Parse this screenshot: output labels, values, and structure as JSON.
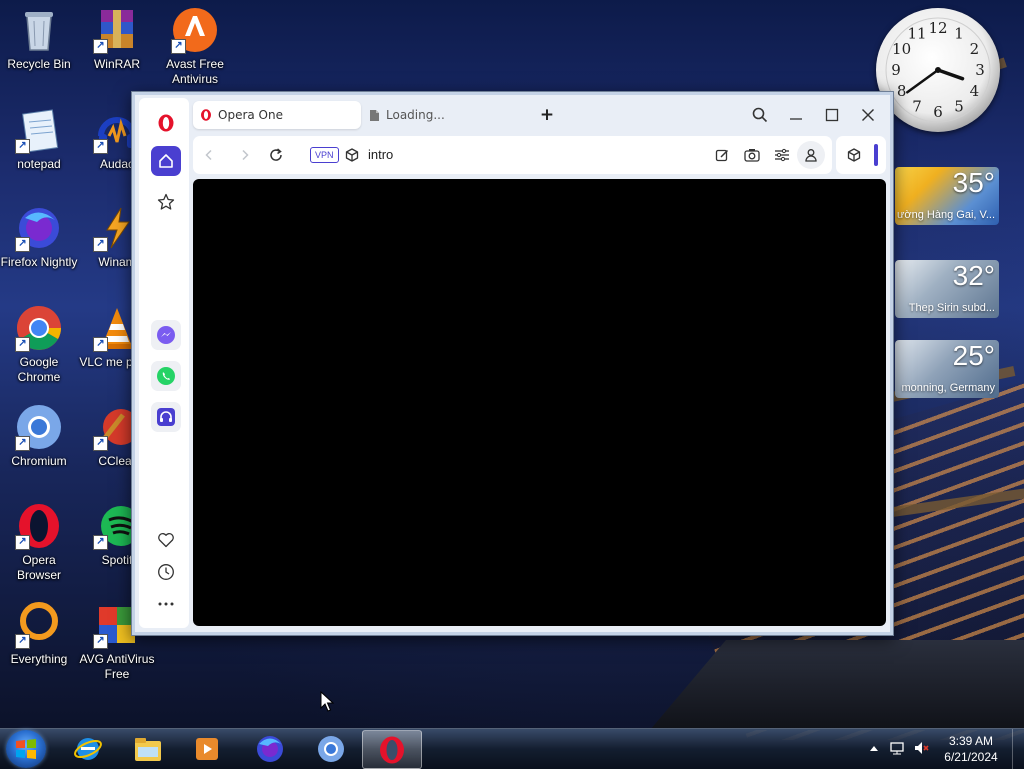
{
  "desktop": {
    "icons": [
      {
        "label": "Recycle Bin",
        "icon": "recycle-bin-icon"
      },
      {
        "label": "WinRAR",
        "icon": "winrar-icon"
      },
      {
        "label": "Avast Free Antivirus",
        "icon": "avast-icon"
      },
      {
        "label": "notepad",
        "icon": "notepad-icon"
      },
      {
        "label": "Audac",
        "icon": "audacity-icon"
      },
      {
        "label": "Firefox Nightly",
        "icon": "firefox-nightly-icon"
      },
      {
        "label": "Winam",
        "icon": "winamp-icon"
      },
      {
        "label": "Google Chrome",
        "icon": "chrome-icon"
      },
      {
        "label": "VLC me playe",
        "icon": "vlc-icon"
      },
      {
        "label": "Chromium",
        "icon": "chromium-icon"
      },
      {
        "label": "CClear",
        "icon": "ccleaner-icon"
      },
      {
        "label": "Opera Browser",
        "icon": "opera-icon"
      },
      {
        "label": "Spotif",
        "icon": "spotify-icon"
      },
      {
        "label": "Everything",
        "icon": "everything-icon"
      },
      {
        "label": "AVG AntiVirus Free",
        "icon": "avg-icon"
      }
    ]
  },
  "gadgets": {
    "clock": {
      "numbers": [
        "12",
        "1",
        "2",
        "3",
        "4",
        "5",
        "6",
        "7",
        "8",
        "9",
        "10",
        "11"
      ],
      "hour": 3,
      "minute": 39
    },
    "weather": [
      {
        "temp": "35°",
        "location": "ường Hàng Gai, V..."
      },
      {
        "temp": "32°",
        "location": "Thep Sirin subd..."
      },
      {
        "temp": "25°",
        "location": "monning, Germany"
      }
    ]
  },
  "browser": {
    "tabs": [
      {
        "label": "Opera One",
        "active": true
      },
      {
        "label": "Loading...",
        "active": false
      }
    ],
    "new_tab": "+",
    "vpn_badge": "VPN",
    "url": "intro",
    "sidebar_icons": [
      "opera-logo-icon",
      "home-icon",
      "star-icon",
      "messenger-icon",
      "whatsapp-icon",
      "music-player-icon",
      "heart-icon",
      "history-icon",
      "more-icon"
    ]
  },
  "taskbar": {
    "apps": [
      "internet-explorer-icon",
      "file-explorer-icon",
      "media-player-icon",
      "firefox-icon",
      "chromium-icon",
      "opera-icon"
    ],
    "active_app": "opera-icon",
    "time": "3:39 AM",
    "date": "6/21/2024"
  },
  "colors": {
    "opera_red": "#e5122b",
    "sidebar_accent": "#4a3fd0",
    "window_frame": "#c4d2e6"
  }
}
